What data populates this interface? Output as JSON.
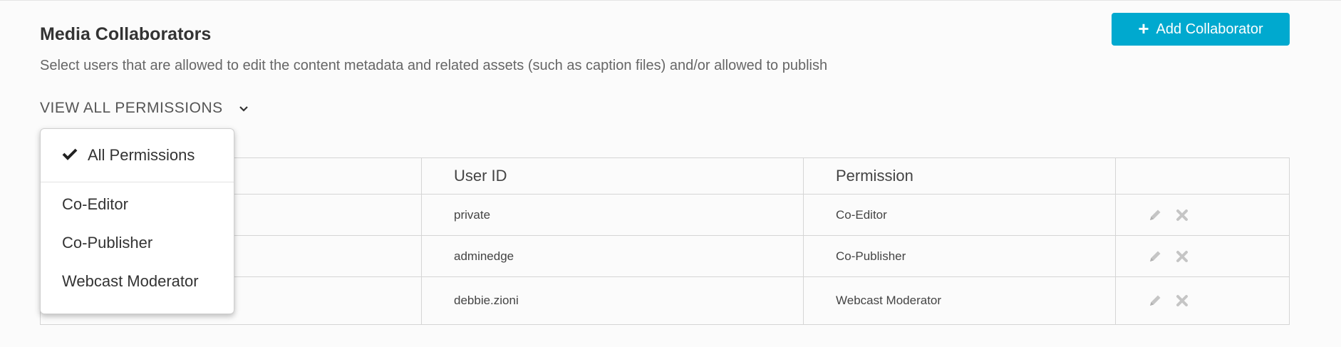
{
  "section": {
    "title": "Media Collaborators",
    "description": "Select users that are allowed to edit the content metadata and related assets (such as caption files) and/or allowed to publish"
  },
  "add_button": {
    "icon": "plus-icon",
    "label": "Add Collaborator",
    "color": "#00a9cf"
  },
  "filter": {
    "label": "VIEW ALL PERMISSIONS",
    "icon": "chevron-down-icon"
  },
  "dropdown": {
    "selected": {
      "icon": "checkmark-icon",
      "label": "All Permissions"
    },
    "options": [
      "Co-Editor",
      "Co-Publisher",
      "Webcast Moderator"
    ]
  },
  "table": {
    "headers": [
      "",
      "User ID",
      "Permission",
      ""
    ],
    "rows": [
      {
        "user_id": "private",
        "permission": "Co-Editor"
      },
      {
        "user_id": "adminedge",
        "permission": "Co-Publisher"
      },
      {
        "user_id": "debbie.zioni",
        "permission": "Webcast Moderator"
      }
    ],
    "row_actions": [
      "pencil-icon",
      "close-icon"
    ]
  }
}
